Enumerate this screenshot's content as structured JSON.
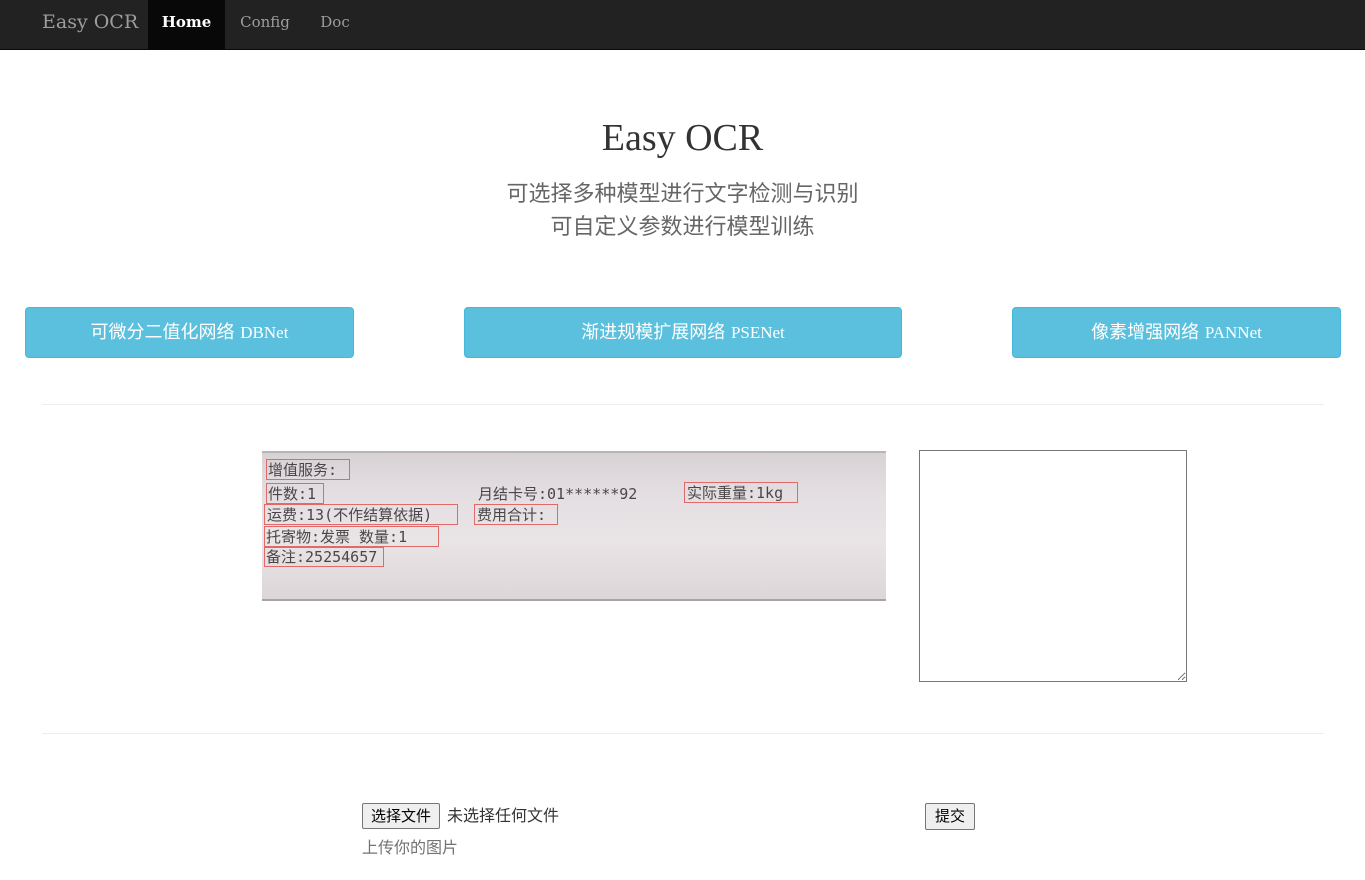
{
  "navbar": {
    "brand": "Easy OCR",
    "items": [
      {
        "label": "Home",
        "active": true
      },
      {
        "label": "Config",
        "active": false
      },
      {
        "label": "Doc",
        "active": false
      }
    ]
  },
  "hero": {
    "title": "Easy OCR",
    "line1": "可选择多种模型进行文字检测与识别",
    "line2": "可自定义参数进行模型训练"
  },
  "models": [
    {
      "label_cn": "可微分二值化网络",
      "label_en": "DBNet"
    },
    {
      "label_cn": "渐进规模扩展网络",
      "label_en": "PSENet"
    },
    {
      "label_cn": "像素增强网络",
      "label_en": "PANNet"
    }
  ],
  "result_image": {
    "lines": [
      "增值服务:",
      "件数:1",
      "月结卡号:01******92",
      "实际重量:1kg",
      "运费:13(不作结算依据)",
      "费用合计:",
      "托寄物:发票  数量:1",
      "备注:25254657"
    ]
  },
  "result_text": {
    "value": ""
  },
  "upload": {
    "choose_label": "选择文件",
    "no_file_label": "未选择任何文件",
    "help": "上传你的图片",
    "submit_label": "提交"
  },
  "colors": {
    "navbar_bg": "#222222",
    "button_info": "#5bc0de",
    "detection_box": "#e06a6a"
  }
}
